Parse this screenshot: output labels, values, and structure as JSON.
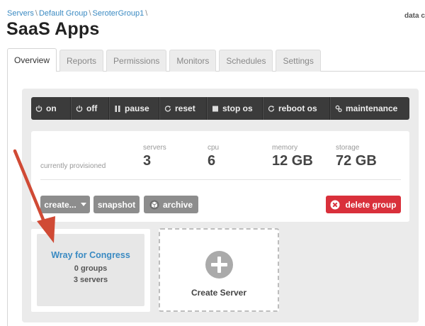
{
  "breadcrumb": {
    "items": [
      "Servers",
      "Default Group",
      "SeroterGroup1"
    ],
    "separator": "\\"
  },
  "top_right_text": "data c",
  "page_title": "SaaS Apps",
  "tabs": [
    {
      "label": "Overview",
      "active": true
    },
    {
      "label": "Reports",
      "active": false
    },
    {
      "label": "Permissions",
      "active": false
    },
    {
      "label": "Monitors",
      "active": false
    },
    {
      "label": "Schedules",
      "active": false
    },
    {
      "label": "Settings",
      "active": false
    }
  ],
  "toolbar": {
    "on": {
      "label": "on",
      "icon": "power-icon"
    },
    "off": {
      "label": "off",
      "icon": "power-icon"
    },
    "pause": {
      "label": "pause",
      "icon": "pause-icon"
    },
    "reset": {
      "label": "reset",
      "icon": "refresh-icon"
    },
    "stop_os": {
      "label": "stop os",
      "icon": "stop-icon"
    },
    "reboot_os": {
      "label": "reboot os",
      "icon": "refresh-icon"
    },
    "maintenance": {
      "label": "maintenance",
      "icon": "gears-icon"
    }
  },
  "stats": {
    "provisioned_label": "currently provisioned",
    "servers": {
      "label": "servers",
      "value": "3"
    },
    "cpu": {
      "label": "cpu",
      "value": "6"
    },
    "memory": {
      "label": "memory",
      "value": "12 GB"
    },
    "storage": {
      "label": "storage",
      "value": "72 GB"
    }
  },
  "actions": {
    "create": "create...",
    "snapshot": "snapshot",
    "archive": "archive",
    "delete_group": "delete group"
  },
  "server_group_card": {
    "name": "Wray for Congress",
    "groups": "0 groups",
    "servers": "3 servers"
  },
  "create_server_label": "Create Server",
  "colors": {
    "link": "#3a8ac2",
    "toolbar_bg": "#3b3b3b",
    "danger": "#d9303b",
    "annotation_arrow": "#d04a35"
  }
}
